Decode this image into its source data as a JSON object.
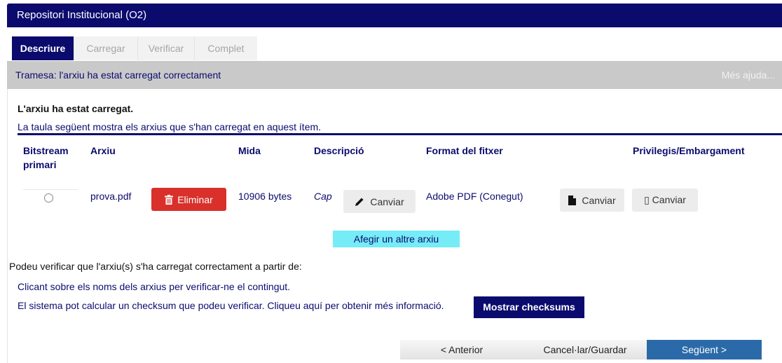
{
  "header": {
    "title": "Repositori Institucional (O2)"
  },
  "tabs": [
    {
      "label": "Descriure",
      "active": true
    },
    {
      "label": "Carregar",
      "active": false
    },
    {
      "label": "Verificar",
      "active": false
    },
    {
      "label": "Complet",
      "active": false
    }
  ],
  "panel": {
    "title": "Tramesa: l'arxiu ha estat carregat correctament",
    "help_link": "Més ajuda..."
  },
  "upload": {
    "loaded_message": "L'arxiu ha estat carregat.",
    "table_caption": "La taula següent mostra els arxius que s'han carregat en aquest ítem."
  },
  "table": {
    "headers": {
      "primary_line1": "Bitstream",
      "primary_line2": "primari",
      "file": "Arxiu",
      "size": "Mida",
      "description": "Descripció",
      "format": "Format del fitxer",
      "privileges": "Privilegis/Embargament"
    },
    "rows": [
      {
        "filename": "prova.pdf",
        "delete_label": "Eliminar",
        "size": "10906 bytes",
        "description": "Cap",
        "change_description_label": "Canviar",
        "format": "Adobe PDF (Conegut)",
        "change_format_label": "Canviar",
        "change_privileges_label": "▯ Canviar"
      }
    ]
  },
  "add_file_label": "Afegir un altre arxiu",
  "verify": {
    "intro": "Podeu verificar que l'arxiu(s) s'ha carregat correctament a partir de:",
    "option1": "Clicant sobre els noms dels arxius per verificar-ne el contingut.",
    "option2": "El sistema pot calcular un checksum que podeu verificar. Cliqueu aquí per obtenir més informació.",
    "checksum_button": "Mostrar checksums"
  },
  "navigation": {
    "previous": "< Anterior",
    "cancel": "Cancel·lar/Guardar",
    "next": "Següent >"
  },
  "colors": {
    "brand_navy": "#0b0b6e",
    "danger": "#d9302b",
    "accent_cyan": "#76ecf7",
    "primary_blue": "#2b6aa8"
  }
}
